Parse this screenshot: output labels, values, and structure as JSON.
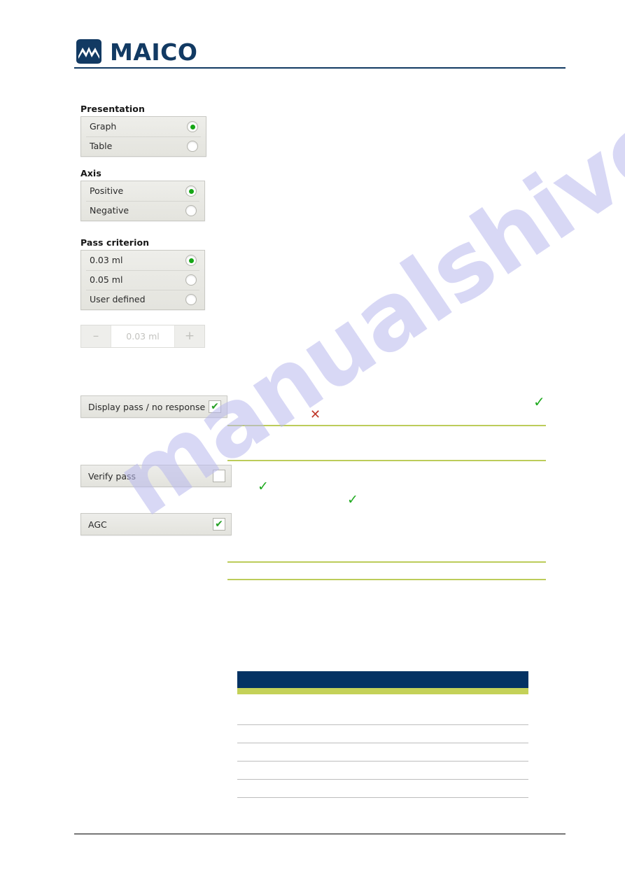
{
  "header": {
    "logo_text": "MAICO",
    "logo_icon": "maico-wave-mark"
  },
  "watermark": {
    "text": "manualshive.com"
  },
  "panels": {
    "presentation": {
      "title": "Presentation",
      "options": [
        {
          "label": "Graph",
          "selected": true
        },
        {
          "label": "Table",
          "selected": false
        }
      ]
    },
    "axis": {
      "title": "Axis",
      "options": [
        {
          "label": "Positive",
          "selected": true
        },
        {
          "label": "Negative",
          "selected": false
        }
      ]
    },
    "pass_criterion": {
      "title": "Pass criterion",
      "options": [
        {
          "label": "0.03 ml",
          "selected": true
        },
        {
          "label": "0.05 ml",
          "selected": false
        },
        {
          "label": "User defined",
          "selected": false
        }
      ]
    }
  },
  "stepper": {
    "decrement_label": "–",
    "value": "0.03 ml",
    "increment_label": "+",
    "disabled": true
  },
  "checkboxes": [
    {
      "label": "Display pass / no response",
      "checked": true,
      "tick": "✔"
    },
    {
      "label": "Verify pass",
      "checked": false,
      "tick": ""
    },
    {
      "label": "AGC",
      "checked": true,
      "tick": "✔"
    }
  ],
  "marks": [
    {
      "type": "cross",
      "glyph": "✕"
    },
    {
      "type": "tick",
      "glyph": "✓"
    },
    {
      "type": "tick",
      "glyph": "✓"
    },
    {
      "type": "tick",
      "glyph": "✓"
    }
  ],
  "table": {
    "header_row_empty": "",
    "rows": [
      "",
      "",
      "",
      "",
      ""
    ]
  },
  "colors": {
    "brand_navy": "#123a63",
    "table_header_navy": "#043263",
    "accent_olive": "#c4d158",
    "rule_olive": "#bccc5a",
    "tick_green": "#1faa1f",
    "cross_red": "#c0392b",
    "watermark_lavender": "#b9b9ee"
  }
}
